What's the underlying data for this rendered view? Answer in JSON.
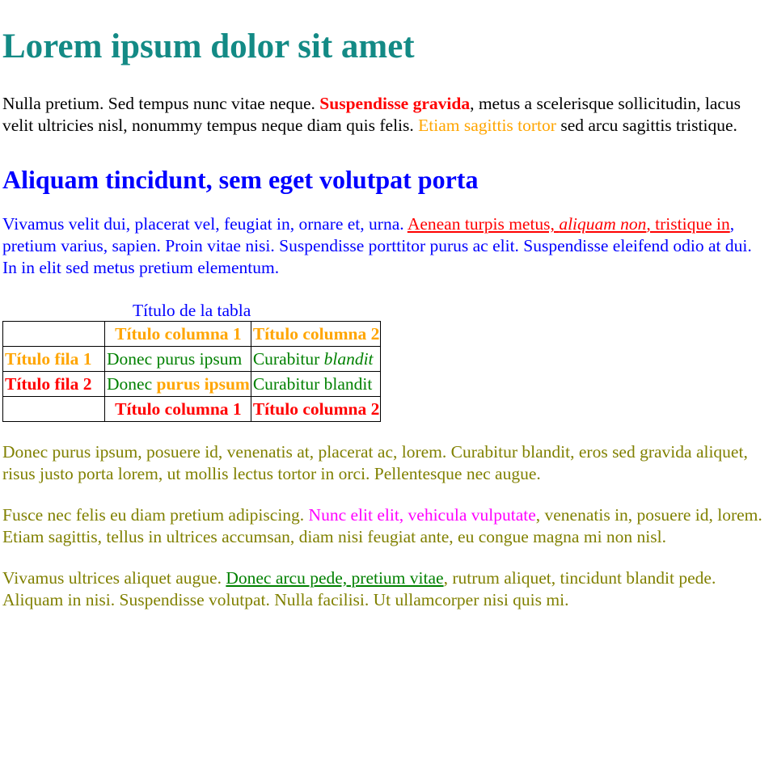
{
  "title": "Lorem ipsum dolor sit amet",
  "para1": {
    "t1": "Nulla pretium. Sed tempus nunc vitae neque. ",
    "bold_red": "Suspendisse gravida",
    "t2": ", metus a scelerisque sollicitudin, lacus velit ultricies nisl, nonummy tempus neque diam quis felis. ",
    "orange": "Etiam sagittis tortor",
    "t3": " sed arcu sagittis tristique."
  },
  "heading2": "Aliquam tincidunt, sem eget volutpat porta",
  "para2": {
    "t1": "Vivamus velit dui, placerat vel, feugiat in, ornare et, urna. ",
    "link_a": "Aenean turpis metus, ",
    "link_italic": "aliquam non",
    "link_b": ", tristique in",
    "t2": ", pretium varius, sapien. Proin vitae nisi. Suspendisse porttitor purus ac elit. Suspendisse eleifend odio at dui. In in elit sed metus pretium elementum."
  },
  "table": {
    "caption": "Título de la tabla",
    "header": [
      "",
      "Título columna 1",
      "Título columna 2"
    ],
    "rows": [
      {
        "head": "Título fila 1",
        "c1": "Donec purus ipsum",
        "c2_plain": "Curabitur ",
        "c2_italic": "blandit"
      },
      {
        "head": "Título fila 2",
        "c1_plain": "Donec ",
        "c1_bold": "purus ipsum",
        "c2": "Curabitur blandit"
      }
    ],
    "footer": [
      "",
      "Título columna 1",
      "Título columna 2"
    ]
  },
  "para3": "Donec purus ipsum, posuere id, venenatis at, placerat ac, lorem. Curabitur blandit, eros sed gravida aliquet, risus justo porta lorem, ut mollis lectus tortor in orci. Pellentesque nec augue.",
  "para4": {
    "t1": "Fusce nec felis eu diam pretium adipiscing. ",
    "magenta": "Nunc elit elit, vehicula vulputate",
    "t2": ", venenatis in, posuere id, lorem. Etiam sagittis, tellus in ultrices accumsan, diam nisi feugiat ante, eu congue magna mi non nisl."
  },
  "para5": {
    "t1": "Vivamus ultrices aliquet augue. ",
    "link": "Donec arcu pede, pretium vitae",
    "t2": ", rutrum aliquet, tincidunt blandit pede. Aliquam in nisi. Suspendisse volutpat. Nulla facilisi. Ut ullamcorper nisi quis mi."
  },
  "colors": {
    "title": "#138a85",
    "heading2": "#0000ff",
    "olive": "#808000",
    "orange": "#ffa500",
    "red": "#ff0000",
    "green": "#008000",
    "magenta": "#ff00ff"
  }
}
